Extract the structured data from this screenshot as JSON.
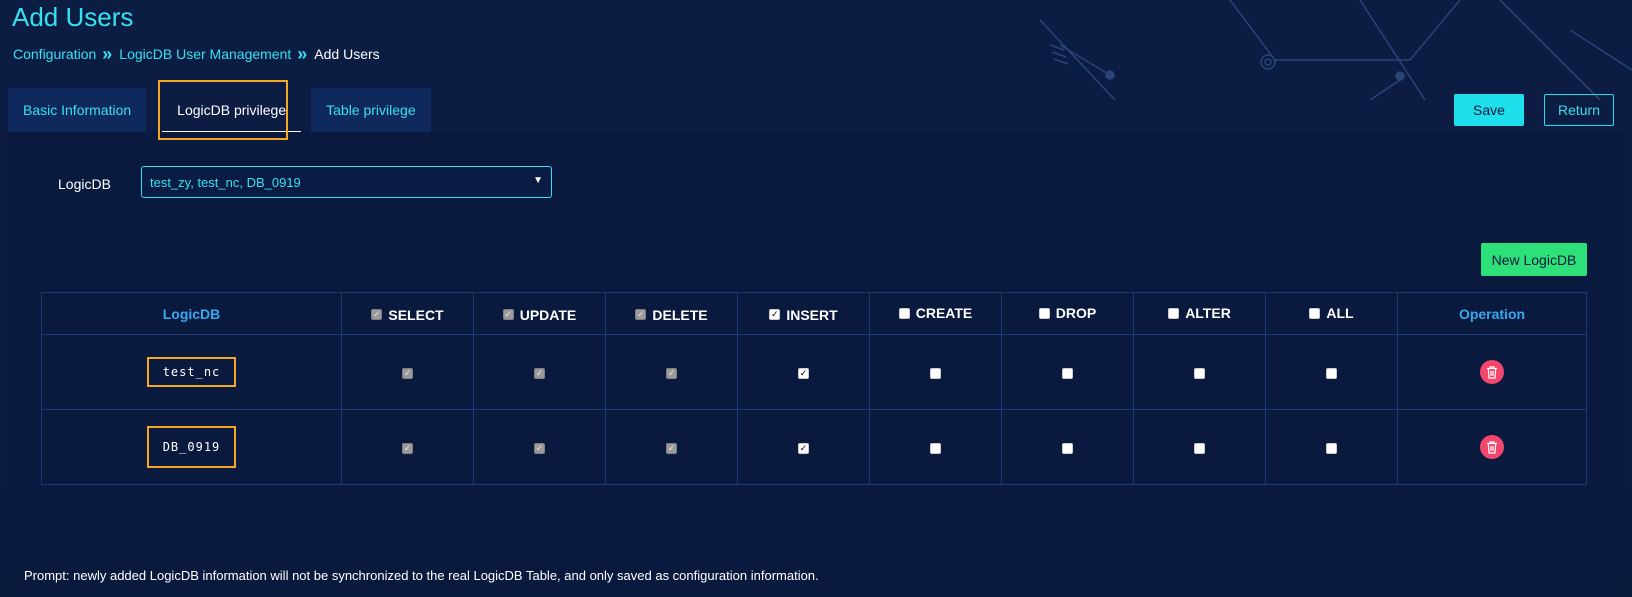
{
  "page": {
    "title": "Add Users"
  },
  "breadcrumb": {
    "items": [
      "Configuration",
      "LogicDB User Management",
      "Add Users"
    ],
    "separator": "»"
  },
  "tabs": [
    {
      "label": "Basic Information",
      "active": false
    },
    {
      "label": "LogicDB privilege",
      "active": true
    },
    {
      "label": "Table privilege",
      "active": false
    }
  ],
  "actions": {
    "save_label": "Save",
    "return_label": "Return"
  },
  "form": {
    "logicdb_label": "LogicDB",
    "logicdb_value": "test_zy, test_nc, DB_0919",
    "dropdown_icon": "caret-down-icon"
  },
  "new_logicdb_label": "New LogicDB",
  "table": {
    "columns": [
      {
        "key": "logicdb",
        "label": "LogicDB",
        "checkbox": null
      },
      {
        "key": "select",
        "label": "SELECT",
        "checkbox": "checked-disabled"
      },
      {
        "key": "update",
        "label": "UPDATE",
        "checkbox": "checked-disabled"
      },
      {
        "key": "delete",
        "label": "DELETE",
        "checkbox": "checked-disabled"
      },
      {
        "key": "insert",
        "label": "INSERT",
        "checkbox": "checked"
      },
      {
        "key": "create",
        "label": "CREATE",
        "checkbox": "unchecked"
      },
      {
        "key": "drop",
        "label": "DROP",
        "checkbox": "unchecked"
      },
      {
        "key": "alter",
        "label": "ALTER",
        "checkbox": "unchecked"
      },
      {
        "key": "all",
        "label": "ALL",
        "checkbox": "unchecked"
      },
      {
        "key": "operation",
        "label": "Operation",
        "checkbox": null
      }
    ],
    "rows": [
      {
        "name": "test_nc",
        "select": "checked-disabled",
        "update": "checked-disabled",
        "delete": "checked-disabled",
        "insert": "checked",
        "create": "unchecked",
        "drop": "unchecked",
        "alter": "unchecked",
        "all": "unchecked",
        "operation_icon": "trash-icon"
      },
      {
        "name": "DB_0919",
        "select": "checked-disabled",
        "update": "checked-disabled",
        "delete": "checked-disabled",
        "insert": "checked",
        "create": "unchecked",
        "drop": "unchecked",
        "alter": "unchecked",
        "all": "unchecked",
        "operation_icon": "trash-icon"
      }
    ]
  },
  "prompt": "Prompt: newly added LogicDB information will not be synchronized to the real LogicDB Table, and only saved as configuration information.",
  "colors": {
    "background": "#0b1a3c",
    "accent_cyan": "#37e0f0",
    "header_blue": "#37a9f0",
    "new_button_green": "#2ee07a",
    "delete_red": "#f2466c",
    "highlight_orange": "#f5a623"
  }
}
